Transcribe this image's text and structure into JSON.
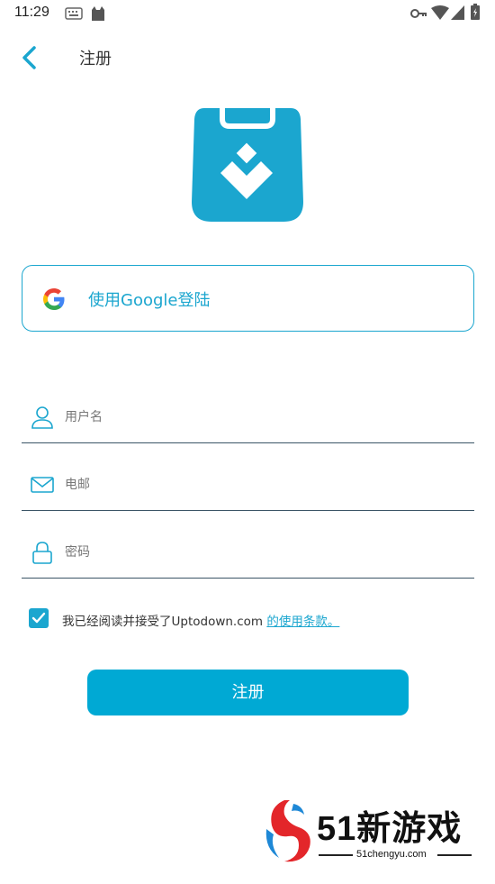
{
  "status_bar": {
    "time": "11:29",
    "icons": [
      "keyboard-icon",
      "cat-icon",
      "vpn-key-icon",
      "wifi-icon",
      "signal-icon",
      "battery-icon"
    ]
  },
  "app_bar": {
    "title": "注册"
  },
  "google_button": {
    "label": "使用Google登陆"
  },
  "form": {
    "username": {
      "placeholder": "用户名",
      "value": ""
    },
    "email": {
      "placeholder": "电邮",
      "value": ""
    },
    "password": {
      "placeholder": "密码",
      "value": ""
    }
  },
  "terms": {
    "checked": true,
    "text": "我已经阅读并接受了Uptodown.com",
    "link": "的使用条款。"
  },
  "submit": {
    "label": "注册"
  },
  "watermark": {
    "text": "51新游戏",
    "sub": "51chengyu.com"
  },
  "colors": {
    "accent": "#00a9d4",
    "divider": "#3b5566"
  }
}
